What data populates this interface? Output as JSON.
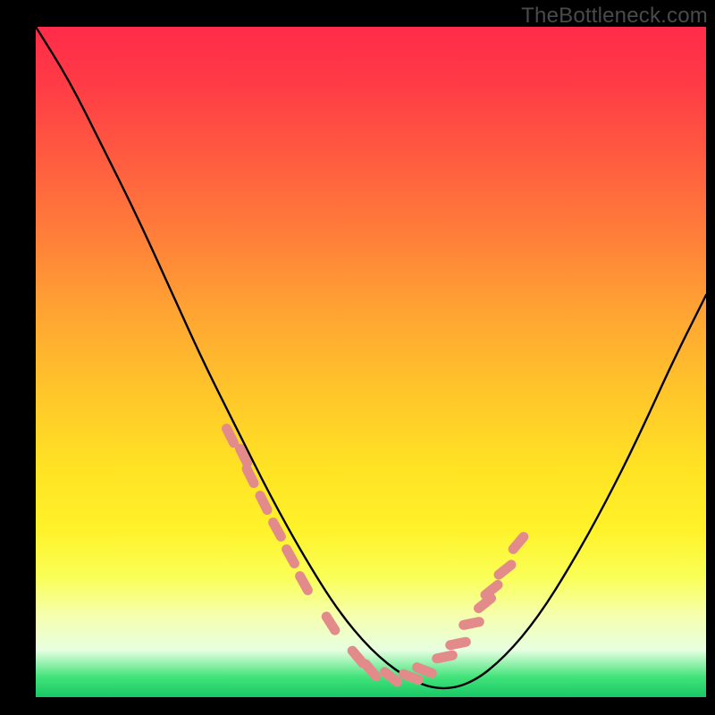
{
  "watermark": "TheBottleneck.com",
  "chart_data": {
    "type": "line",
    "title": "",
    "xlabel": "",
    "ylabel": "",
    "xlim": [
      0,
      100
    ],
    "ylim": [
      0,
      100
    ],
    "series": [
      {
        "name": "curve",
        "x": [
          0,
          5,
          10,
          15,
          20,
          25,
          30,
          35,
          40,
          45,
          50,
          55,
          60,
          65,
          70,
          75,
          80,
          85,
          90,
          95,
          100
        ],
        "y": [
          100,
          92,
          82,
          72,
          61,
          50,
          40,
          30,
          21,
          13,
          7,
          3,
          1,
          2,
          6,
          12,
          20,
          29,
          39,
          50,
          60
        ]
      }
    ],
    "markers": {
      "name": "dots",
      "x": [
        29,
        31,
        32,
        34,
        36,
        38,
        40,
        44,
        48,
        50,
        53,
        56,
        58,
        61,
        63,
        65,
        67,
        68,
        70,
        72
      ],
      "y": [
        39,
        36,
        33,
        29,
        25,
        21,
        17,
        11,
        6,
        4,
        3,
        3,
        4,
        6,
        8,
        11,
        14,
        16,
        19,
        23
      ]
    },
    "background_gradient": {
      "stops": [
        {
          "pos": 0.0,
          "color": "#ff2b4a"
        },
        {
          "pos": 0.3,
          "color": "#ff7b3a"
        },
        {
          "pos": 0.55,
          "color": "#ffc72a"
        },
        {
          "pos": 0.75,
          "color": "#fff22a"
        },
        {
          "pos": 0.9,
          "color": "#f0ffc0"
        },
        {
          "pos": 1.0,
          "color": "#18c866"
        }
      ]
    }
  }
}
